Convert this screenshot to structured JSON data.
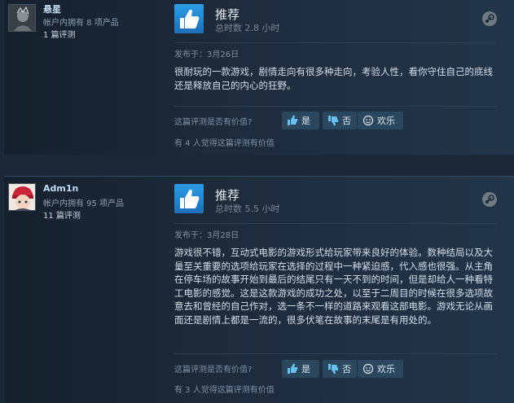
{
  "reviews": [
    {
      "user": {
        "name": "悬星",
        "products": "帐户内拥有 8 项产品",
        "reviews": "1 篇评测"
      },
      "verdict": "推荐",
      "hours": "总时数 2.8 小时",
      "posted": "发布于：3月26日",
      "text": "很耐玩的一款游戏，剧情走向有很多种走向，考验人性，看你守住自己的底线还是释放自己的内心的狂野。",
      "helpful_question": "这篇评测是否有价值?",
      "buttons": {
        "yes": "是",
        "no": "否",
        "funny": "欢乐"
      },
      "helpful_count": "有 4 人觉得这篇评测有价值"
    },
    {
      "user": {
        "name": "Adm1n",
        "products": "帐户内拥有 95 项产品",
        "reviews": "11 篇评测"
      },
      "verdict": "推荐",
      "hours": "总时数 5.5 小时",
      "posted": "发布于：3月28日",
      "text": "游戏很不错，互动式电影的游戏形式给玩家带来良好的体验。数种结局以及大量至关重要的选项给玩家在选择的过程中一种紧迫感，代入感也很强。从主角在停车场的故事开始到最后的结尾只有一天不到的时间，但是却给人一种看特工电影的感觉。这是这款游戏的成功之处，以至于二周目的时候在很多选项故意去和曾经的自己作对，选一条不一样的道路来观看这部电影。游戏无论从画面还是剧情上都是一流的，很多伏笔在故事的末尾是有用处的。",
      "helpful_question": "这篇评测是否有价值?",
      "buttons": {
        "yes": "是",
        "no": "否",
        "funny": "欢乐"
      },
      "helpful_count": "有 3 人觉得这篇评测有价值"
    }
  ]
}
